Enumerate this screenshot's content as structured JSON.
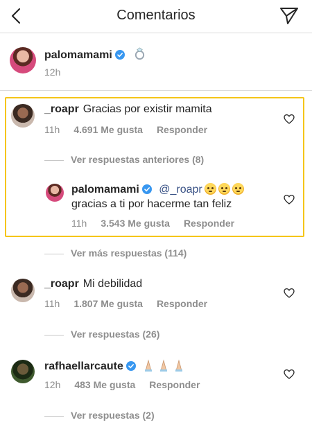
{
  "header": {
    "title": "Comentarios",
    "back_icon": "back-arrow-icon",
    "send_icon": "direct-send-icon"
  },
  "caption": {
    "username": "palomamami",
    "verified": true,
    "text_icon": "ring-icon",
    "time": "12h"
  },
  "comments": [
    {
      "username": "_roapr",
      "text": "Gracias por existir mamita",
      "time": "11h",
      "likes": "4.691 Me gusta",
      "reply_label": "Responder",
      "view_previous": "Ver respuestas anteriores (8)",
      "reply": {
        "username": "palomamami",
        "mention": "@_roapr",
        "text_line2": "gracias a ti por hacerme tan feliz",
        "time": "11h",
        "likes": "3.543 Me gusta",
        "reply_label": "Responder"
      },
      "view_more": "Ver más respuestas (114)"
    },
    {
      "username": "_roapr",
      "text": "Mi debilidad",
      "time": "11h",
      "likes": "1.807 Me gusta",
      "reply_label": "Responder",
      "view_replies": "Ver respuestas (26)"
    },
    {
      "username": "rafhaellarcaute",
      "verified": true,
      "text_icon": "praying-hands-icon",
      "time": "12h",
      "likes": "483 Me gusta",
      "reply_label": "Responder",
      "view_replies": "Ver respuestas (2)"
    }
  ],
  "colors": {
    "verified_blue": "#3897f0",
    "highlight_border": "#f5c518",
    "meta_gray": "#8e8e8e",
    "mention_blue": "#385185"
  }
}
